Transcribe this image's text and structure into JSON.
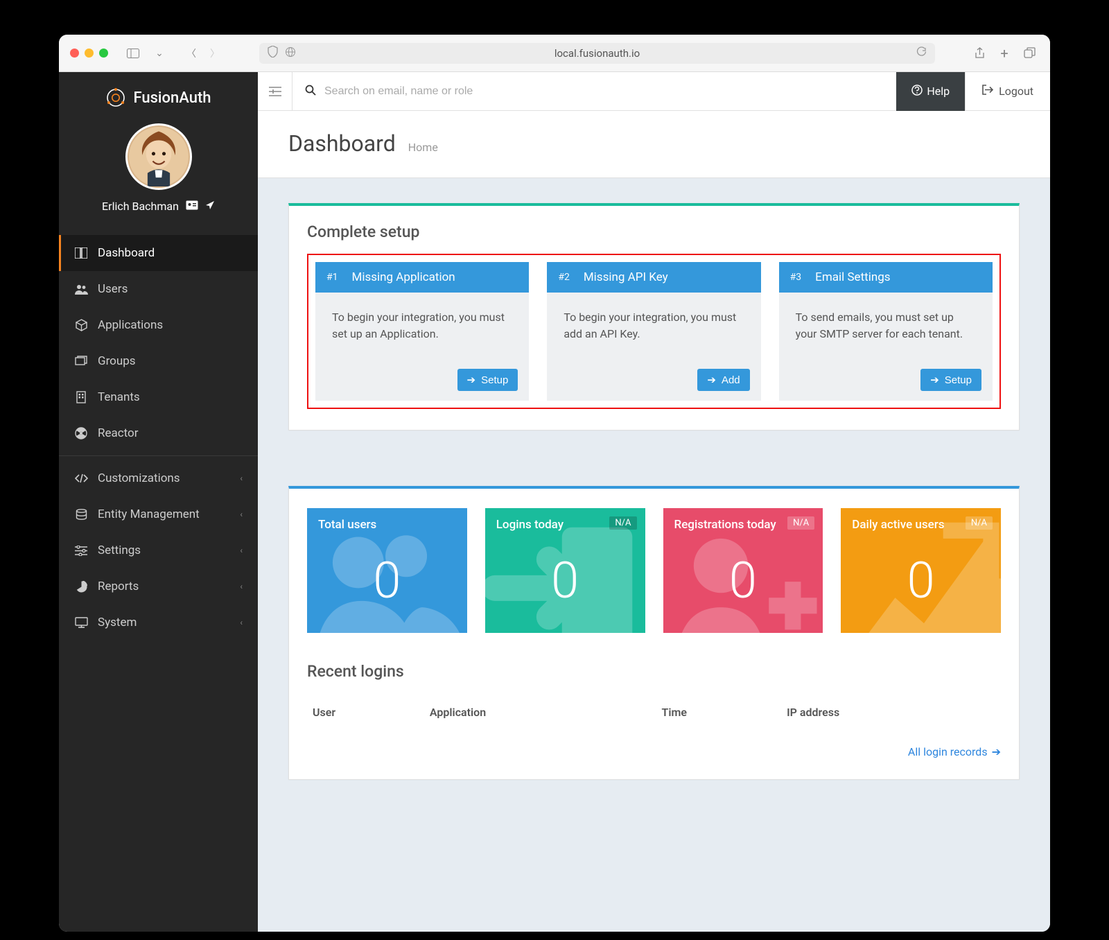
{
  "browser": {
    "url": "local.fusionauth.io"
  },
  "brand": {
    "name": "FusionAuth"
  },
  "user": {
    "name": "Erlich Bachman"
  },
  "topbar": {
    "search_placeholder": "Search on email, name or role",
    "help_label": "Help",
    "logout_label": "Logout"
  },
  "page": {
    "title": "Dashboard",
    "breadcrumb": "Home"
  },
  "sidebar": {
    "items": [
      {
        "label": "Dashboard",
        "icon": "dashboard-icon",
        "active": true
      },
      {
        "label": "Users",
        "icon": "users-icon"
      },
      {
        "label": "Applications",
        "icon": "cube-icon"
      },
      {
        "label": "Groups",
        "icon": "layers-icon"
      },
      {
        "label": "Tenants",
        "icon": "building-icon"
      },
      {
        "label": "Reactor",
        "icon": "radioactive-icon"
      }
    ],
    "secondary": [
      {
        "label": "Customizations",
        "icon": "code-icon",
        "expandable": true
      },
      {
        "label": "Entity Management",
        "icon": "database-icon",
        "expandable": true
      },
      {
        "label": "Settings",
        "icon": "sliders-icon",
        "expandable": true
      },
      {
        "label": "Reports",
        "icon": "piechart-icon",
        "expandable": true
      },
      {
        "label": "System",
        "icon": "monitor-icon",
        "expandable": true
      }
    ]
  },
  "setup": {
    "title": "Complete setup",
    "cards": [
      {
        "num": "#1",
        "title": "Missing Application",
        "body": "To begin your integration, you must set up an Application.",
        "button": "Setup"
      },
      {
        "num": "#2",
        "title": "Missing API Key",
        "body": "To begin your integration, you must add an API Key.",
        "button": "Add"
      },
      {
        "num": "#3",
        "title": "Email Settings",
        "body": "To send emails, you must set up your SMTP server for each tenant.",
        "button": "Setup"
      }
    ]
  },
  "stats": [
    {
      "label": "Total users",
      "value": "0",
      "badge": "",
      "color": "c-blue"
    },
    {
      "label": "Logins today",
      "value": "0",
      "badge": "N/A",
      "color": "c-green"
    },
    {
      "label": "Registrations today",
      "value": "0",
      "badge": "N/A",
      "color": "c-red"
    },
    {
      "label": "Daily active users",
      "value": "0",
      "badge": "N/A",
      "color": "c-orange"
    }
  ],
  "recent": {
    "title": "Recent logins",
    "columns": [
      "User",
      "Application",
      "Time",
      "IP address"
    ],
    "all_link": "All login records"
  }
}
